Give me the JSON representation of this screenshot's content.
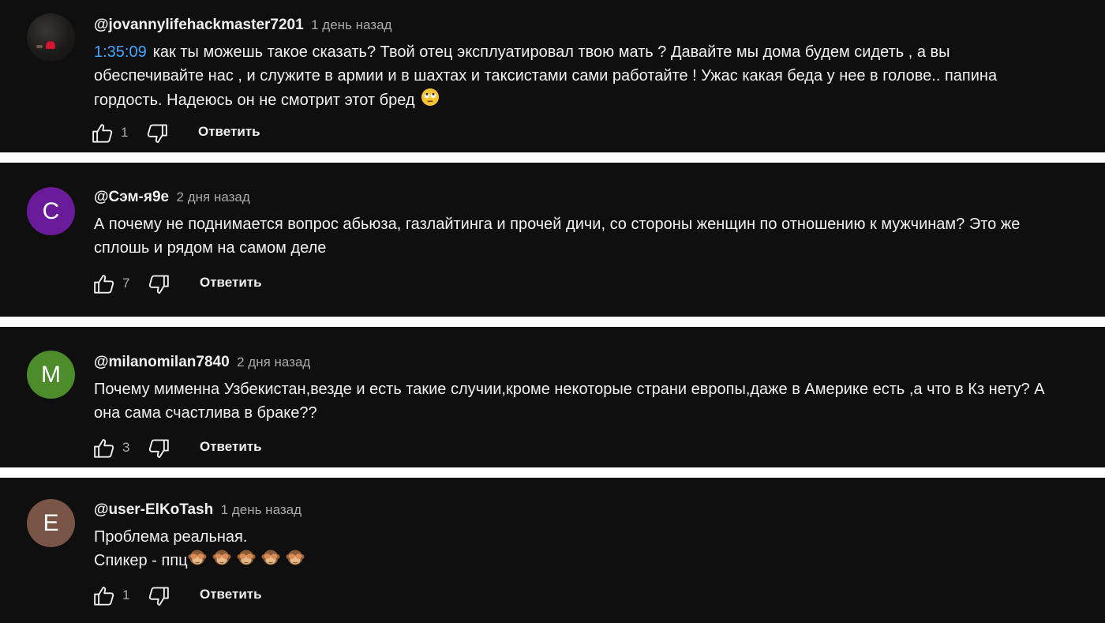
{
  "comments": [
    {
      "author": "@jovannylifehackmaster7201",
      "time": "1 день назад",
      "timestamp": "1:35:09",
      "lines": [
        "как ты можешь такое сказать? Твой отец эксплуатировал твою мать ? Давайте мы дома будем сидеть , а вы",
        "обеспечивайте нас , и служите в армии и в шахтах и таксистами сами работайте ! Ужас какая беда у нее в голове.. папина",
        "гордость. Надеюсь он не смотрит этот бред"
      ],
      "emoji": "face-with-rolling-eyes",
      "likes": "1",
      "reply": "Ответить",
      "avatar": {
        "type": "photo"
      }
    },
    {
      "author": "@Сэм-я9е",
      "time": "2 дня назад",
      "lines": [
        "А почему не поднимается вопрос абьюза, газлайтинга и прочей дичи, со стороны женщин по отношению к мужчинам? Это же",
        "сплошь и рядом на самом деле"
      ],
      "likes": "7",
      "reply": "Ответить",
      "avatar": {
        "type": "letter",
        "letter": "С",
        "color": "#6a1b9a"
      }
    },
    {
      "author": "@milanomilan7840",
      "time": "2 дня назад",
      "lines": [
        "Почему мименна Узбекистан,везде и есть такие случии,кроме некоторые страни европы,даже в Америке есть ,а что в Кз нету? А",
        "она сама счастлива в браке??"
      ],
      "likes": "3",
      "reply": "Ответить",
      "avatar": {
        "type": "letter",
        "letter": "M",
        "color": "#4c8c2a"
      }
    },
    {
      "author": "@user-ElKoTash",
      "time": "1 день назад",
      "lines": [
        "Проблема реальная.",
        "Спикер - ппц"
      ],
      "emoji_run": "see-no-evil-monkey x5",
      "likes": "1",
      "reply": "Ответить",
      "avatar": {
        "type": "letter",
        "letter": "E",
        "color": "#795548"
      }
    }
  ],
  "icons": {
    "like": "thumb-up-icon",
    "dislike": "thumb-down-icon"
  },
  "colors": {
    "background": "#0f0f0f",
    "separator": "#ffffff",
    "text": "#f1f1f1",
    "secondary_text": "#aaaaaa",
    "timestamp_link": "#3ea6ff"
  }
}
